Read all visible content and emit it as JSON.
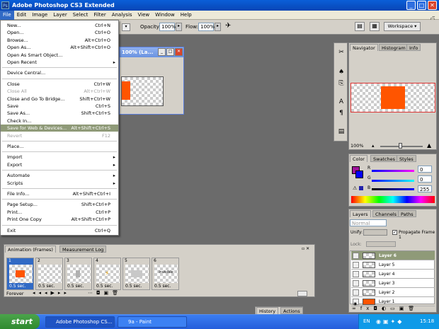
{
  "window": {
    "title": "Adobe Photoshop CS3 Extended",
    "ps_icon": "Ps",
    "controls": [
      "_",
      "□",
      "✕"
    ]
  },
  "menubar": [
    "File",
    "Edit",
    "Image",
    "Layer",
    "Select",
    "Filter",
    "Analysis",
    "View",
    "Window",
    "Help"
  ],
  "optionsbar": {
    "opacity_label": "Opacity:",
    "opacity_value": "100%",
    "flow_label": "Flow:",
    "flow_value": "100%",
    "workspace_label": "Workspace ▾"
  },
  "file_menu": [
    {
      "label": "New...",
      "shortcut": "Ctrl+N"
    },
    {
      "label": "Open...",
      "shortcut": "Ctrl+O"
    },
    {
      "label": "Browse...",
      "shortcut": "Alt+Ctrl+O"
    },
    {
      "label": "Open As...",
      "shortcut": "Alt+Shift+Ctrl+O"
    },
    {
      "label": "Open As Smart Object...",
      "shortcut": ""
    },
    {
      "label": "Open Recent",
      "shortcut": "",
      "sub": true
    },
    {
      "sep": true
    },
    {
      "label": "Device Central...",
      "shortcut": ""
    },
    {
      "sep": true
    },
    {
      "label": "Close",
      "shortcut": "Ctrl+W"
    },
    {
      "label": "Close All",
      "shortcut": "Alt+Ctrl+W",
      "disabled": true
    },
    {
      "label": "Close and Go To Bridge...",
      "shortcut": "Shift+Ctrl+W"
    },
    {
      "label": "Save",
      "shortcut": "Ctrl+S"
    },
    {
      "label": "Save As...",
      "shortcut": "Shift+Ctrl+S"
    },
    {
      "label": "Check In...",
      "shortcut": ""
    },
    {
      "label": "Save for Web & Devices...",
      "shortcut": "Alt+Shift+Ctrl+S",
      "highlight": true
    },
    {
      "label": "Revert",
      "shortcut": "F12",
      "disabled": true
    },
    {
      "sep": true
    },
    {
      "label": "Place...",
      "shortcut": ""
    },
    {
      "sep": true
    },
    {
      "label": "Import",
      "shortcut": "",
      "sub": true
    },
    {
      "label": "Export",
      "shortcut": "",
      "sub": true
    },
    {
      "sep": true
    },
    {
      "label": "Automate",
      "shortcut": "",
      "sub": true
    },
    {
      "label": "Scripts",
      "shortcut": "",
      "sub": true
    },
    {
      "sep": true
    },
    {
      "label": "File Info...",
      "shortcut": "Alt+Shift+Ctrl+I"
    },
    {
      "sep": true
    },
    {
      "label": "Page Setup...",
      "shortcut": "Shift+Ctrl+P"
    },
    {
      "label": "Print...",
      "shortcut": "Ctrl+P"
    },
    {
      "label": "Print One Copy",
      "shortcut": "Alt+Shift+Ctrl+P"
    },
    {
      "sep": true
    },
    {
      "label": "Exit",
      "shortcut": "Ctrl+Q"
    }
  ],
  "document": {
    "title": "100% (La...",
    "controls": [
      "_",
      "□",
      "✕"
    ]
  },
  "navigator": {
    "tabs": [
      "Navigator",
      "Histogram",
      "Info"
    ],
    "zoom": "100%"
  },
  "color_panel": {
    "tabs": [
      "Color",
      "Swatches",
      "Styles"
    ],
    "channels": [
      {
        "label": "R",
        "value": "0"
      },
      {
        "label": "G",
        "value": "0"
      },
      {
        "label": "B",
        "value": "255"
      }
    ]
  },
  "layers_panel": {
    "tabs": [
      "Layers",
      "Channels",
      "Paths"
    ],
    "blend_mode": "Normal",
    "unify_label": "Unify:",
    "propagate_label": "Propagate Frame 1",
    "lock_label": "Lock:",
    "layers": [
      {
        "name": "Layer 6",
        "selected": true
      },
      {
        "name": "Layer 5"
      },
      {
        "name": "Layer 4"
      },
      {
        "name": "Layer 3"
      },
      {
        "name": "Layer 2"
      },
      {
        "name": "Layer 1"
      }
    ]
  },
  "history_panel": {
    "tabs": [
      "History",
      "Actions"
    ]
  },
  "animation_panel": {
    "tabs": [
      "Animation (Frames)",
      "Measurement Log"
    ],
    "loop": "Forever",
    "frames": [
      {
        "num": "1",
        "delay": "0.5 sec.",
        "selected": true
      },
      {
        "num": "2",
        "delay": "0.5 sec."
      },
      {
        "num": "3",
        "delay": "0.5 sec."
      },
      {
        "num": "4",
        "delay": "0.5 sec."
      },
      {
        "num": "5",
        "delay": "0.5 sec."
      },
      {
        "num": "6",
        "delay": "0.5 sec.",
        "caption": "Invisible"
      }
    ]
  },
  "taskbar": {
    "start": "start",
    "items": [
      "Adobe Photoshop CS...",
      "9a - Paint"
    ],
    "lang": "EN",
    "clock": "15:18"
  },
  "colors": {
    "accent_orange": "#ff5500",
    "menu_highlight": "#8f9a78",
    "xp_blue": "#245edb"
  }
}
